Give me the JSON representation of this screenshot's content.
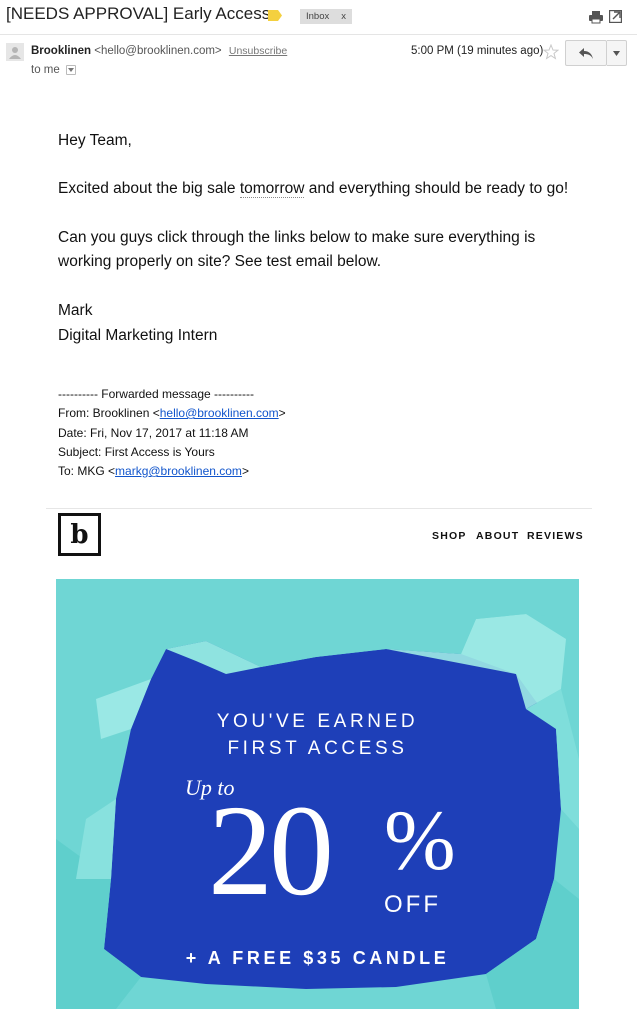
{
  "subject_bar": {
    "subject": "[NEEDS APPROVAL] Early Access",
    "label_chip": "Inbox",
    "label_chip_close": "x",
    "label_color": "#f4d03f"
  },
  "message_header": {
    "sender_name": "Brooklinen",
    "sender_email": "<hello@brooklinen.com>",
    "unsubscribe": "Unsubscribe",
    "time": "5:00 PM (19 minutes ago)",
    "to": "to me",
    "icons": [
      "avatar-icon",
      "star-icon",
      "reply-icon",
      "more-icon",
      "print-icon",
      "new-window-icon"
    ]
  },
  "body": {
    "greeting": "Hey Team,",
    "para1_before": "Excited about the big sale ",
    "para1_dotted": "tomorrow",
    "para1_after": " and everything should be ready to go!",
    "para2_line1": "Can you guys click through the links below to make sure everything is",
    "para2_line2": "working properly on site? See test email below.",
    "sig_name": "Mark",
    "sig_title": "Digital Marketing Intern"
  },
  "forwarded": {
    "header": "---------- Forwarded message ----------",
    "from_label": "From: Brooklinen <",
    "from_email": "hello@brooklinen.com",
    "from_close": ">",
    "date": "Date: Fri, Nov 17, 2017 at 11:18 AM",
    "subject": "Subject: First Access is Yours",
    "to_label": "To: MKG <",
    "to_email": "markg@brooklinen.com",
    "to_close": ">"
  },
  "newsletter": {
    "logo": "b",
    "nav": [
      "SHOP",
      "ABOUT",
      "REVIEWS"
    ],
    "hero": {
      "line1": "YOU'VE EARNED",
      "line2": "FIRST ACCESS",
      "up_to": "Up to",
      "number": "20",
      "percent": "%",
      "off": "OFF",
      "line3": "+ A FREE $35 CANDLE",
      "bg_blue": "#1e3fb8",
      "paper_teal": "#6fd6d4"
    }
  }
}
